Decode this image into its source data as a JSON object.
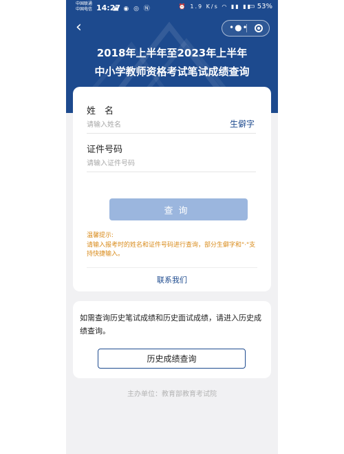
{
  "status_bar": {
    "carrier_1": "中国联通",
    "carrier_2": "中国电信",
    "time": "14:27",
    "speed": "1.9 K/s",
    "battery": "53%"
  },
  "nav": {
    "more_icon": "more-dots-icon",
    "close_icon": "target-icon"
  },
  "header": {
    "title_line1": "2018年上半年至2023年上半年",
    "title_line2": "中小学教师资格考试笔试成绩查询"
  },
  "form": {
    "name_label": "姓　名",
    "name_placeholder": "请输入姓名",
    "name_value": "",
    "rare_char_link": "生僻字",
    "id_label": "证件号码",
    "id_placeholder": "请输入证件号码",
    "id_value": "",
    "query_button": "查询"
  },
  "tips": {
    "title": "温馨提示:",
    "text": "请输入报考时的姓名和证件号码进行查询，部分生僻字和\"·\"支持快捷输入。"
  },
  "contact": "联系我们",
  "history": {
    "text": "如需查询历史笔试成绩和历史面试成绩，请进入历史成绩查询。",
    "button": "历史成绩查询"
  },
  "footer": {
    "organizer": "主办单位：教育部教育考试院"
  },
  "colors": {
    "header_bg": "#1d4a8e",
    "query_button_bg": "#9bb6de",
    "tip_color": "#d98b1b"
  }
}
